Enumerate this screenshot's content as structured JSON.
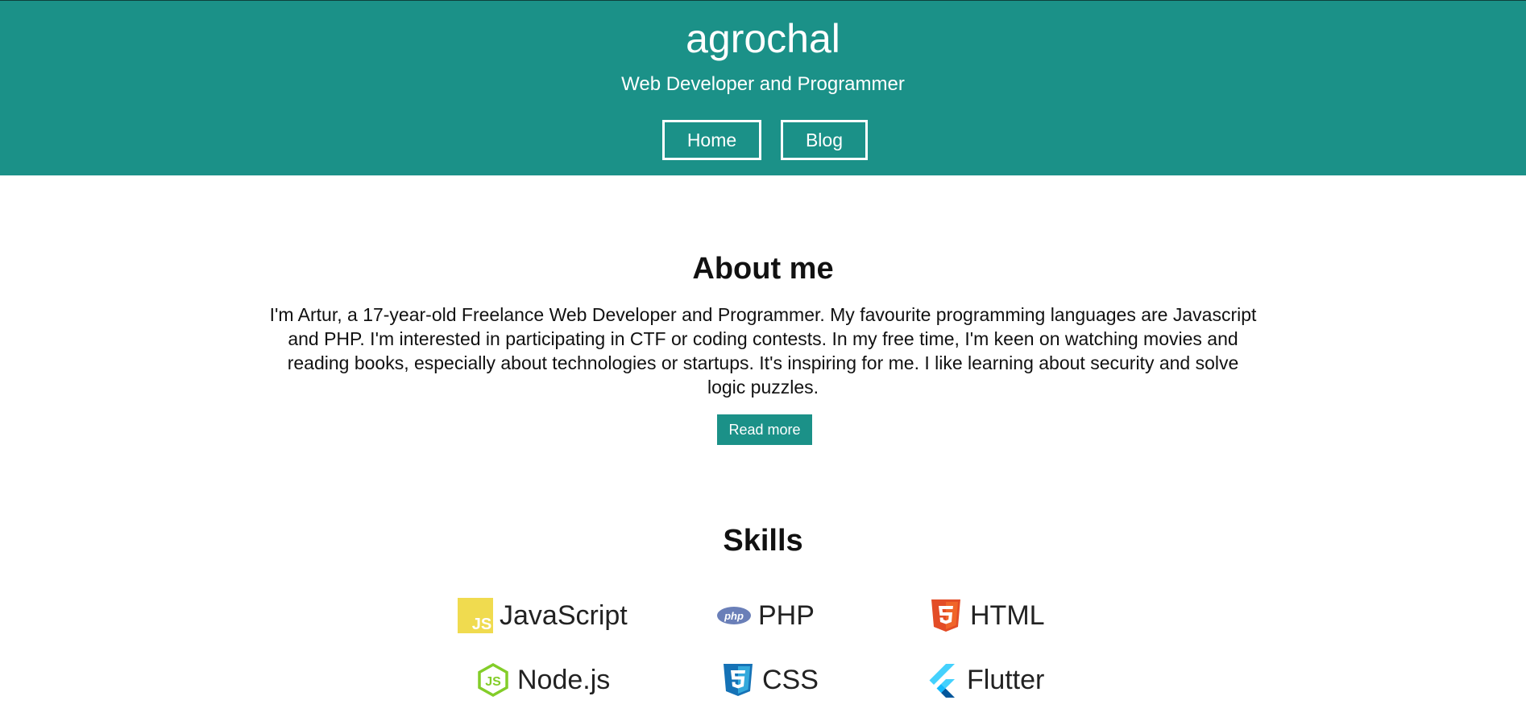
{
  "header": {
    "title": "agrochal",
    "subtitle": "Web Developer and Programmer",
    "nav": {
      "home": "Home",
      "blog": "Blog"
    }
  },
  "about": {
    "title": "About me",
    "text": "I'm Artur, a 17-year-old Freelance Web Developer and Programmer. My favourite programming languages are Javascript and PHP. I'm interested in participating in CTF or coding contests. In my free time, I'm keen on watching movies and reading books, especially about technologies or startups. It's inspiring for me. I like learning about security and solve logic puzzles.",
    "button": "Read more"
  },
  "skills": {
    "title": "Skills",
    "items": [
      {
        "label": "JavaScript",
        "icon": "javascript-icon"
      },
      {
        "label": "PHP",
        "icon": "php-icon"
      },
      {
        "label": "HTML",
        "icon": "html5-icon"
      },
      {
        "label": "Node.js",
        "icon": "nodejs-icon"
      },
      {
        "label": "CSS",
        "icon": "css3-icon"
      },
      {
        "label": "Flutter",
        "icon": "flutter-icon"
      }
    ]
  },
  "colors": {
    "primary": "#1b9188",
    "text": "#111111",
    "background": "#ffffff"
  }
}
